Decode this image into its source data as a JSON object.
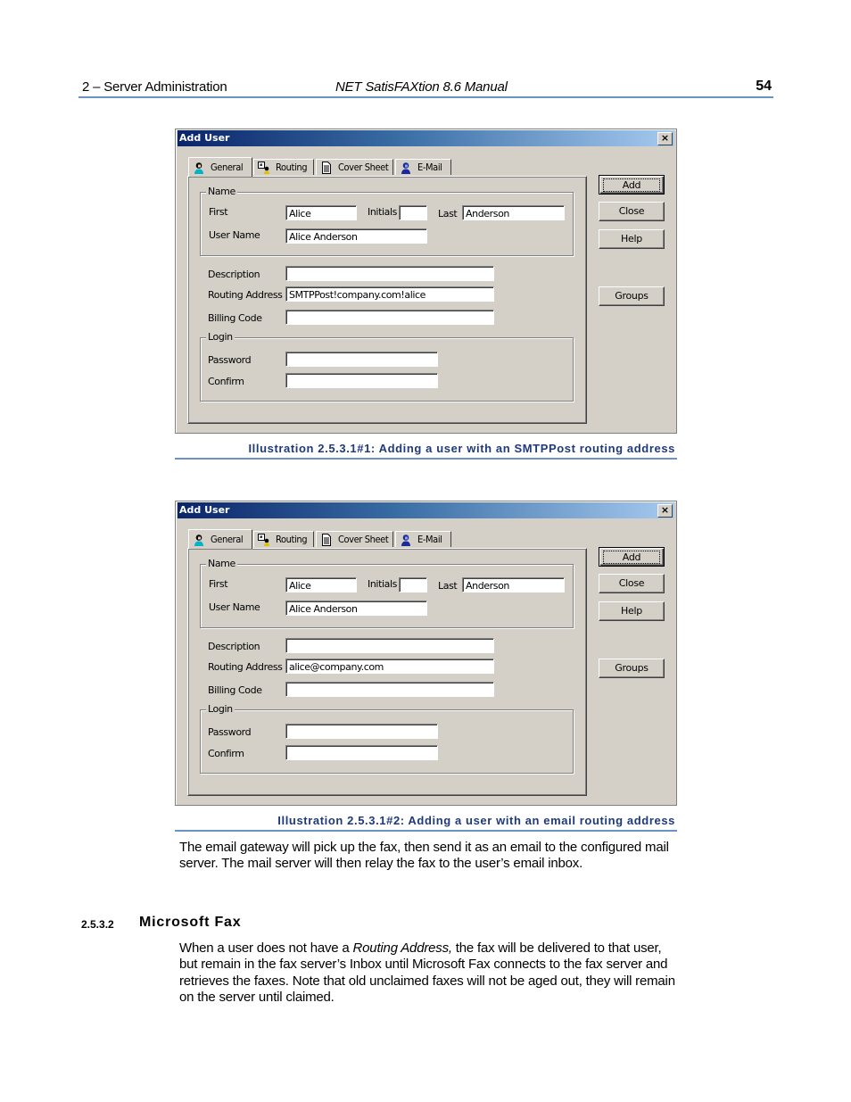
{
  "page_header": {
    "chapter": "2  – Server Administration",
    "manual_title": "NET SatisFAXtion 8.6 Manual",
    "page_number": "54"
  },
  "dialogs": [
    {
      "title": "Add User",
      "close_glyph": "×",
      "tabs": [
        {
          "label": "General",
          "icon": "user-icon",
          "active": true
        },
        {
          "label": "Routing",
          "icon": "routing-icon",
          "active": false
        },
        {
          "label": "Cover Sheet",
          "icon": "document-icon",
          "active": false
        },
        {
          "label": "E-Mail",
          "icon": "email-user-icon",
          "active": false
        }
      ],
      "name_group": {
        "legend": "Name",
        "first_label": "First",
        "first_value": "Alice",
        "initials_label": "Initials",
        "initials_value": "",
        "last_label": "Last",
        "last_value": "Anderson",
        "username_label": "User Name",
        "username_value": "Alice Anderson"
      },
      "description_label": "Description",
      "description_value": "",
      "routing_label": "Routing Address",
      "routing_value": "SMTPPost!company.com!alice",
      "billing_label": "Billing Code",
      "billing_value": "",
      "login_group": {
        "legend": "Login",
        "password_label": "Password",
        "password_value": "",
        "confirm_label": "Confirm",
        "confirm_value": ""
      },
      "buttons": {
        "add": "Add",
        "close": "Close",
        "help": "Help",
        "groups": "Groups"
      },
      "caption": "Illustration 2.5.3.1#1: Adding a user with an SMTPPost routing address"
    },
    {
      "title": "Add User",
      "close_glyph": "×",
      "tabs": [
        {
          "label": "General",
          "icon": "user-icon",
          "active": true
        },
        {
          "label": "Routing",
          "icon": "routing-icon",
          "active": false
        },
        {
          "label": "Cover Sheet",
          "icon": "document-icon",
          "active": false
        },
        {
          "label": "E-Mail",
          "icon": "email-user-icon",
          "active": false
        }
      ],
      "name_group": {
        "legend": "Name",
        "first_label": "First",
        "first_value": "Alice",
        "initials_label": "Initials",
        "initials_value": "",
        "last_label": "Last",
        "last_value": "Anderson",
        "username_label": "User Name",
        "username_value": "Alice Anderson"
      },
      "description_label": "Description",
      "description_value": "",
      "routing_label": "Routing Address",
      "routing_value": "alice@company.com",
      "billing_label": "Billing Code",
      "billing_value": "",
      "login_group": {
        "legend": "Login",
        "password_label": "Password",
        "password_value": "",
        "confirm_label": "Confirm",
        "confirm_value": ""
      },
      "buttons": {
        "add": "Add",
        "close": "Close",
        "help": "Help",
        "groups": "Groups"
      },
      "caption": "Illustration 2.5.3.1#2: Adding a user with an email routing address"
    }
  ],
  "body": {
    "paragraph1": "The email gateway will pick up the fax, then send it as an email to the configured mail server. The mail server will then relay the fax to the user’s email inbox.",
    "section_number": "2.5.3.2",
    "section_title": "Microsoft Fax",
    "paragraph2_before": "When a user does not have a ",
    "paragraph2_italic": "Routing Address,",
    "paragraph2_after": " the fax will be delivered to that user, but remain in the fax server’s Inbox until Microsoft Fax connects to the fax server and retrieves the faxes. Note that old unclaimed faxes will not be aged out, they will remain on the server until claimed."
  },
  "colors": {
    "accent_rule": "#6a93c5",
    "caption_text": "#1f3a7a",
    "dialog_face": "#d4d0c8",
    "titlebar_start": "#0a246a",
    "titlebar_end": "#a6caf0"
  }
}
